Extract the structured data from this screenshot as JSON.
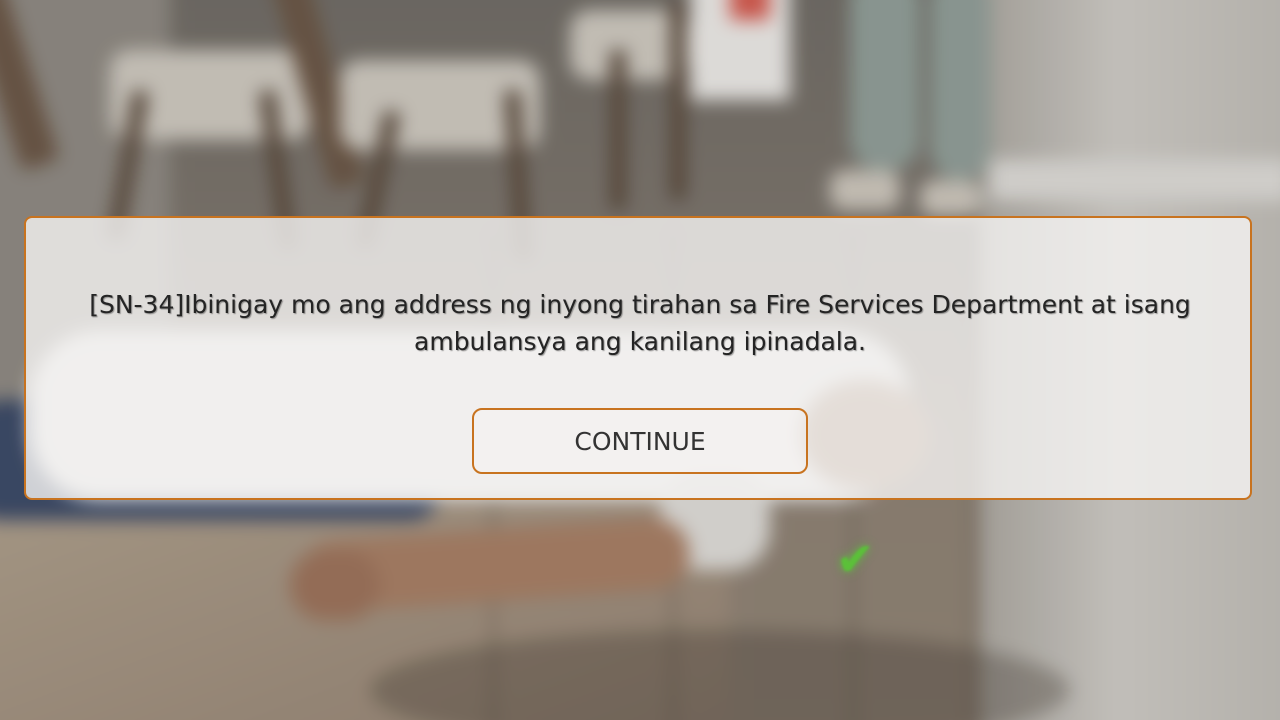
{
  "dialog": {
    "message": "[SN-34]Ibinigay mo ang address ng inyong tirahan sa Fire Services Department at isang ambulansya ang kanilang ipinadala.",
    "continue_label": "CONTINUE"
  },
  "scene": {
    "checkmark_icon": "checkmark-icon",
    "checkmark_color": "#5fc83c",
    "accent_color": "#c8731f"
  }
}
